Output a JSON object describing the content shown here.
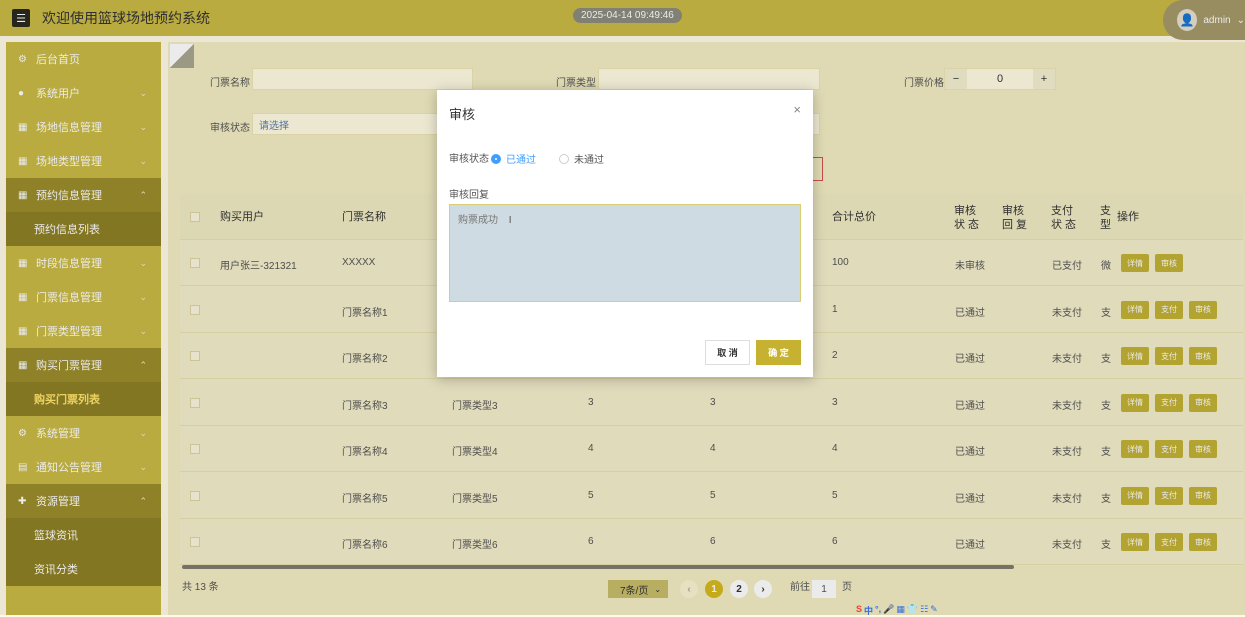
{
  "header": {
    "menu_icon": "☰",
    "title": "欢迎使用篮球场地预约系统",
    "datetime": "2025-04-14 09:49:46",
    "user": "admin"
  },
  "sidebar": {
    "items": [
      {
        "icon": "gear-icon",
        "glyph": "⚙",
        "label": "后台首页",
        "chev": ""
      },
      {
        "icon": "user-icon",
        "glyph": "●",
        "label": "系统用户",
        "chev": "⌄"
      },
      {
        "icon": "grid-icon",
        "glyph": "▦",
        "label": "场地信息管理",
        "chev": "⌄"
      },
      {
        "icon": "grid-icon",
        "glyph": "▦",
        "label": "场地类型管理",
        "chev": "⌄"
      },
      {
        "icon": "grid-icon",
        "glyph": "▦",
        "label": "预约信息管理",
        "chev": "⌃"
      },
      {
        "icon": "",
        "glyph": "",
        "label": "预约信息列表",
        "chev": ""
      },
      {
        "icon": "grid-icon",
        "glyph": "▦",
        "label": "时段信息管理",
        "chev": "⌄"
      },
      {
        "icon": "grid-icon",
        "glyph": "▦",
        "label": "门票信息管理",
        "chev": "⌄"
      },
      {
        "icon": "grid-icon",
        "glyph": "▦",
        "label": "门票类型管理",
        "chev": "⌄"
      },
      {
        "icon": "grid-icon",
        "glyph": "▦",
        "label": "购买门票管理",
        "chev": "⌃"
      },
      {
        "icon": "",
        "glyph": "",
        "label": "购买门票列表",
        "chev": ""
      },
      {
        "icon": "gear-icon",
        "glyph": "⚙",
        "label": "系统管理",
        "chev": "⌄"
      },
      {
        "icon": "doc-icon",
        "glyph": "▤",
        "label": "通知公告管理",
        "chev": "⌄"
      },
      {
        "icon": "plus-icon",
        "glyph": "✚",
        "label": "资源管理",
        "chev": "⌃"
      },
      {
        "icon": "",
        "glyph": "",
        "label": "篮球资讯",
        "chev": ""
      },
      {
        "icon": "",
        "glyph": "",
        "label": "资讯分类",
        "chev": ""
      }
    ]
  },
  "filters": {
    "ticket_name_label": "门票名称",
    "ticket_type_label": "门票类型",
    "ticket_price_label": "门票价格",
    "price_value": "0",
    "minus": "−",
    "plus": "+",
    "status_label": "审核状态",
    "status_placeholder": "请选择"
  },
  "table": {
    "headers": [
      "购买用户",
      "门票名称",
      "合计总价",
      "审核状\n态",
      "审核回\n复",
      "支付状\n态",
      "支\n型",
      "操作"
    ],
    "rows": [
      {
        "user": "用户张三-321321",
        "name": "XXXXX",
        "type": "",
        "qty": "",
        "price": "",
        "total": "100",
        "audit": "未审核",
        "pay": "已支付",
        "ptype": "微",
        "ops": [
          "详情",
          "审核"
        ]
      },
      {
        "user": "",
        "name": "门票名称1",
        "type": "",
        "qty": "",
        "price": "",
        "total": "1",
        "audit": "已通过",
        "pay": "未支付",
        "ptype": "支",
        "ops": [
          "详情",
          "支付",
          "审核"
        ]
      },
      {
        "user": "",
        "name": "门票名称2",
        "type": "",
        "qty": "",
        "price": "",
        "total": "2",
        "audit": "已通过",
        "pay": "未支付",
        "ptype": "支",
        "ops": [
          "详情",
          "支付",
          "审核"
        ]
      },
      {
        "user": "",
        "name": "门票名称3",
        "type": "门票类型3",
        "qty": "3",
        "price": "3",
        "total": "3",
        "audit": "已通过",
        "pay": "未支付",
        "ptype": "支",
        "ops": [
          "详情",
          "支付",
          "审核"
        ]
      },
      {
        "user": "",
        "name": "门票名称4",
        "type": "门票类型4",
        "qty": "4",
        "price": "4",
        "total": "4",
        "audit": "已通过",
        "pay": "未支付",
        "ptype": "支",
        "ops": [
          "详情",
          "支付",
          "审核"
        ]
      },
      {
        "user": "",
        "name": "门票名称5",
        "type": "门票类型5",
        "qty": "5",
        "price": "5",
        "total": "5",
        "audit": "已通过",
        "pay": "未支付",
        "ptype": "支",
        "ops": [
          "详情",
          "支付",
          "审核"
        ]
      },
      {
        "user": "",
        "name": "门票名称6",
        "type": "门票类型6",
        "qty": "6",
        "price": "6",
        "total": "6",
        "audit": "已通过",
        "pay": "未支付",
        "ptype": "支",
        "ops": [
          "详情",
          "支付",
          "审核"
        ]
      }
    ]
  },
  "pagination": {
    "total": "共 13 条",
    "page_size": "7条/页",
    "prev": "‹",
    "pages": [
      "1",
      "2"
    ],
    "next": "›",
    "goto_label": "前往",
    "goto_value": "1",
    "page_suffix": "页"
  },
  "modal": {
    "title": "审核",
    "close": "×",
    "status_label": "审核状态",
    "option_pass": "已通过",
    "option_fail": "未通过",
    "reply_label": "审核回复",
    "reply_value": "购票成功",
    "cancel": "取 消",
    "ok": "确 定"
  },
  "ime": {
    "items": [
      "S",
      "中",
      "°,",
      "🎤",
      "▦",
      "👕",
      "☷",
      "✎"
    ]
  },
  "colors": {
    "accent": "#c9ba45",
    "button": "#c3b136",
    "radio": "#409eff",
    "page_active": "#d6b91c"
  }
}
